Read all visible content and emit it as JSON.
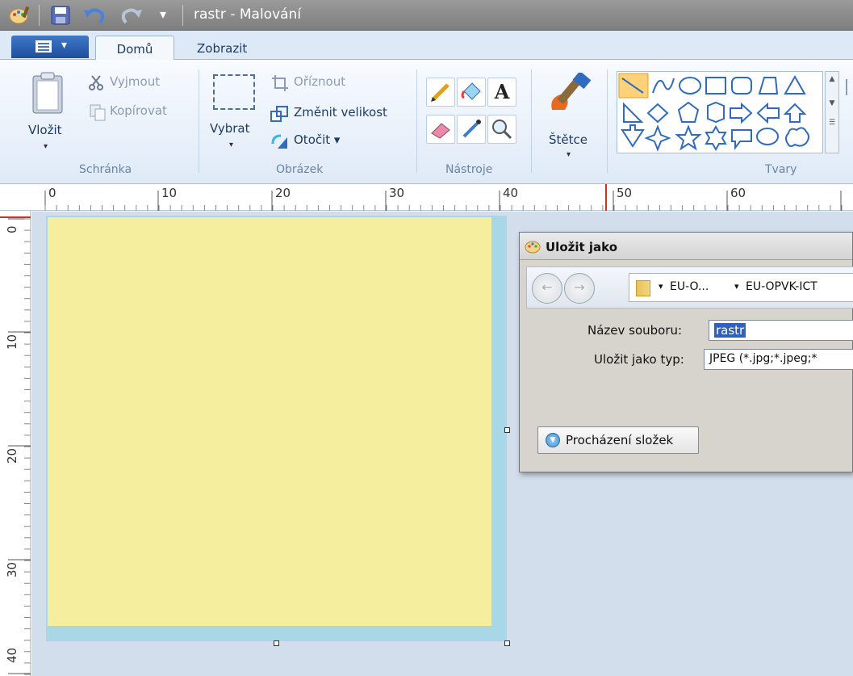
{
  "window": {
    "title": "rastr - Malování"
  },
  "tabs": [
    {
      "label": "Domů",
      "active": true
    },
    {
      "label": "Zobrazit",
      "active": false
    }
  ],
  "ribbon": {
    "clipboard": {
      "paste": "Vložit",
      "cut": "Vyjmout",
      "copy": "Kopírovat",
      "group": "Schránka"
    },
    "image": {
      "select": "Vybrat",
      "crop": "Oříznout",
      "resize": "Změnit velikost",
      "rotate": "Otočit ▾",
      "group": "Obrázek"
    },
    "tools": {
      "group": "Nástroje"
    },
    "brushes": {
      "label": "Štětce"
    },
    "shapes": {
      "group": "Tvary"
    }
  },
  "ruler": {
    "h": [
      "0",
      "10",
      "20",
      "30",
      "40",
      "50",
      "60"
    ],
    "v": [
      "0",
      "10",
      "20",
      "30",
      "40"
    ]
  },
  "canvas": {
    "fill_color": "#f4ee9e",
    "border_color": "#a8d8e8"
  },
  "dialog": {
    "title": "Uložit jako",
    "breadcrumb": [
      "EU-O...",
      "EU-OPVK-ICT"
    ],
    "filename_label": "Název souboru:",
    "filename_value": "rastr",
    "filetype_label": "Uložit jako typ:",
    "filetype_value": "JPEG (*.jpg;*.jpeg;*",
    "browse_button": "Procházení složek"
  }
}
